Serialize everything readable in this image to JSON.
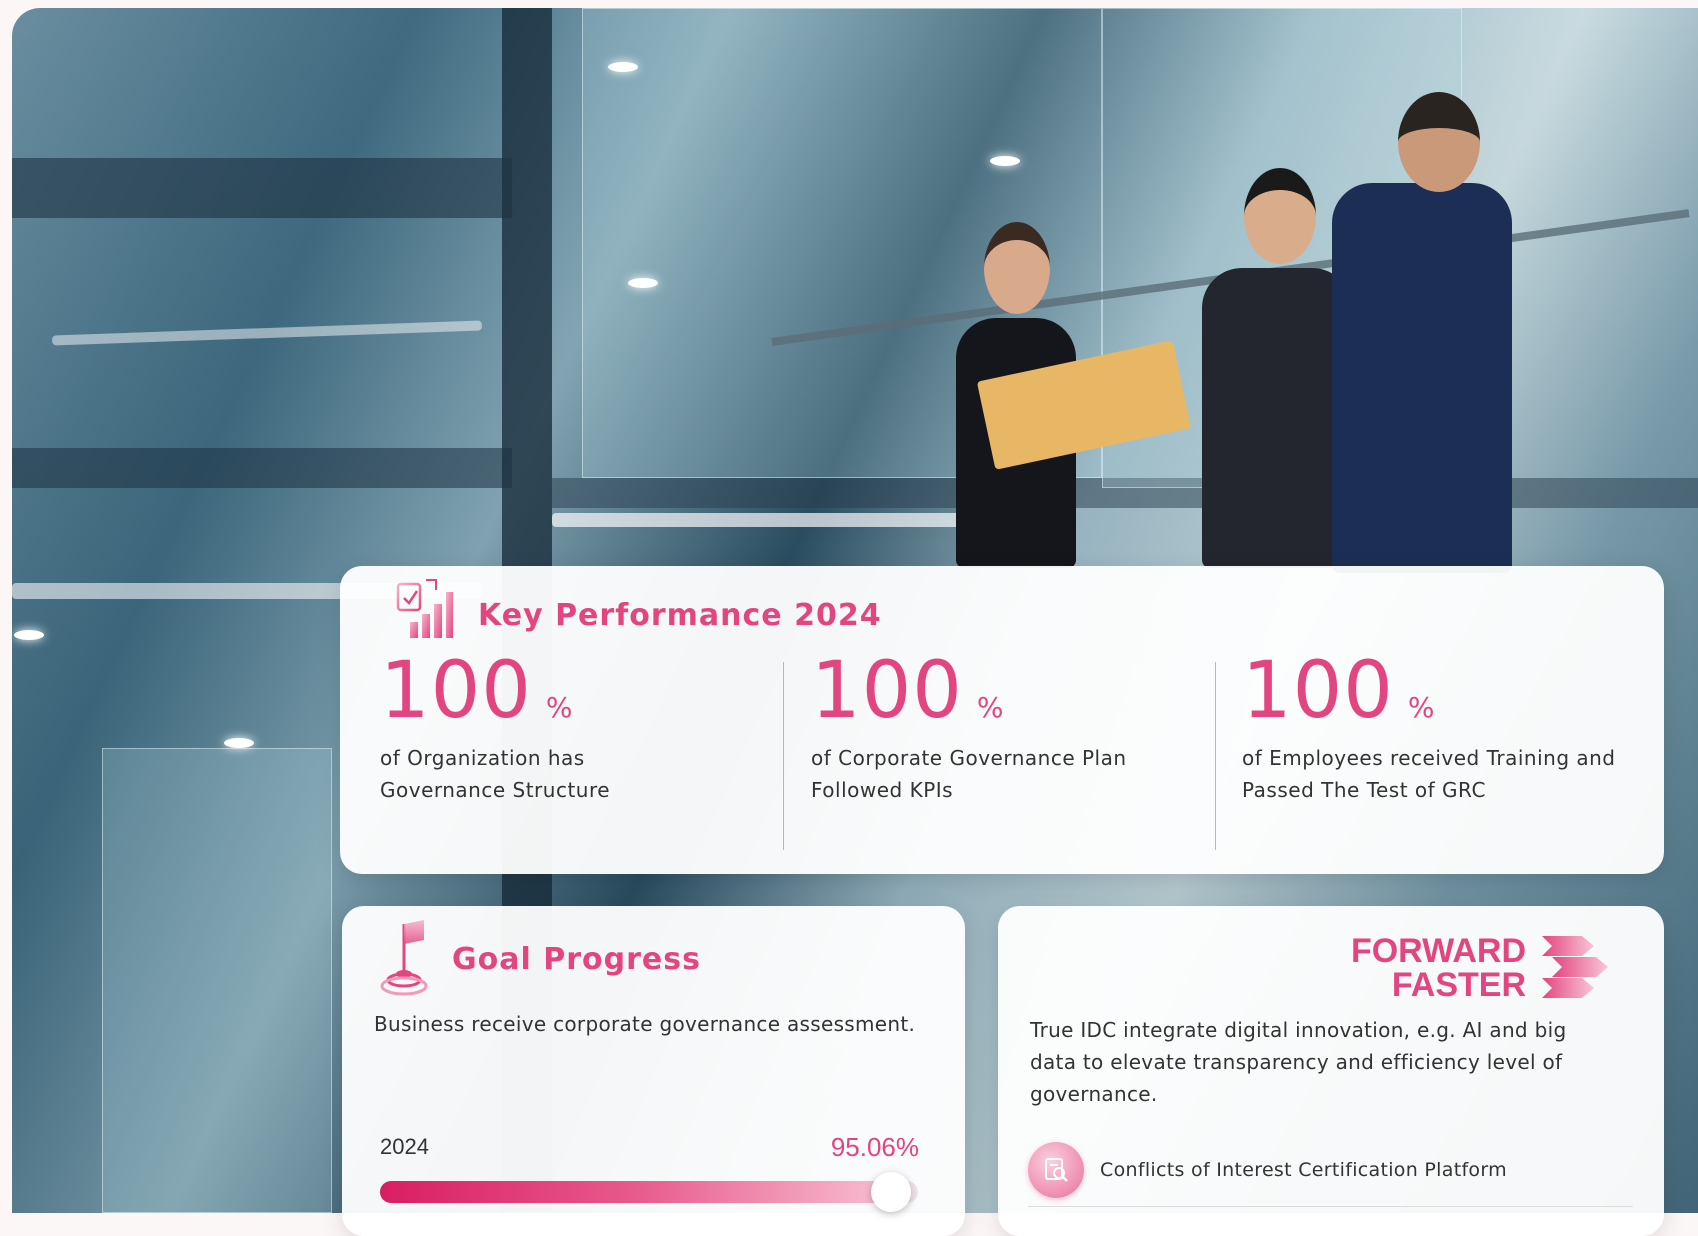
{
  "key_performance": {
    "title": "Key Performance 2024",
    "stats": [
      {
        "value": "100",
        "unit": "%",
        "desc_line1": "of Organization has",
        "desc_line2": "Governance Structure"
      },
      {
        "value": "100",
        "unit": "%",
        "desc_line1": "of Corporate Governance Plan",
        "desc_line2": "Followed KPIs"
      },
      {
        "value": "100",
        "unit": "%",
        "desc_line1": "of Employees received Training and",
        "desc_line2": "Passed The Test of GRC"
      }
    ]
  },
  "goal_progress": {
    "title": "Goal Progress",
    "description": "Business receive corporate governance assessment.",
    "year": "2024",
    "percent_label": "95.06%",
    "progress_fraction": 0.9506
  },
  "forward_faster": {
    "logo_line1": "FORWARD",
    "logo_line2": "FASTER",
    "description": "True IDC integrate digital innovation, e.g. AI and big data to elevate transparency and efficiency level of governance.",
    "items": [
      {
        "label": "Conflicts of Interest Certification Platform",
        "icon": "certificate-search-icon"
      }
    ]
  },
  "colors": {
    "accent": "#e2457f",
    "text": "#333333"
  }
}
